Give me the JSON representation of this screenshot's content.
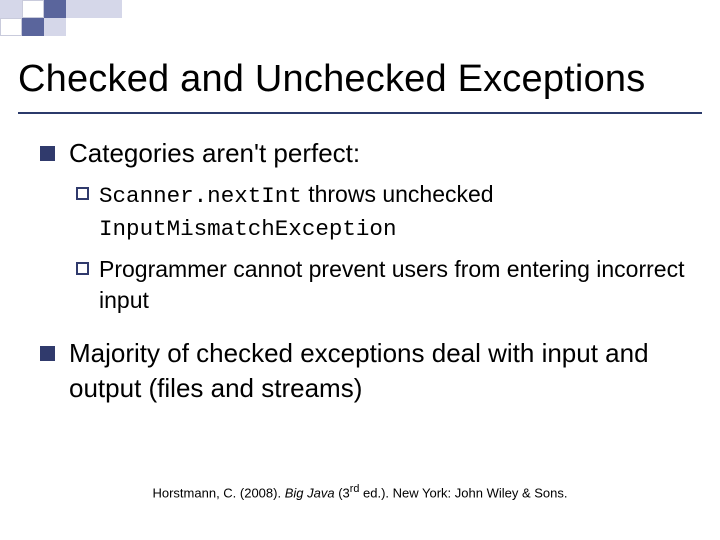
{
  "title": "Checked and Unchecked Exceptions",
  "points": {
    "p1": "Categories aren't perfect:",
    "p1a_code1": "Scanner.nextInt",
    "p1a_mid": " throws unchecked ",
    "p1a_code2": "InputMismatchException",
    "p1b": "Programmer cannot prevent users from entering incorrect input",
    "p2": "Majority of checked exceptions deal with input and output (files and streams)"
  },
  "citation": {
    "author": "Horstmann, C. (2008). ",
    "title_italic": "Big Java ",
    "edition": "(3",
    "ord": "rd",
    "rest": " ed.). New York: John Wiley & Sons."
  }
}
